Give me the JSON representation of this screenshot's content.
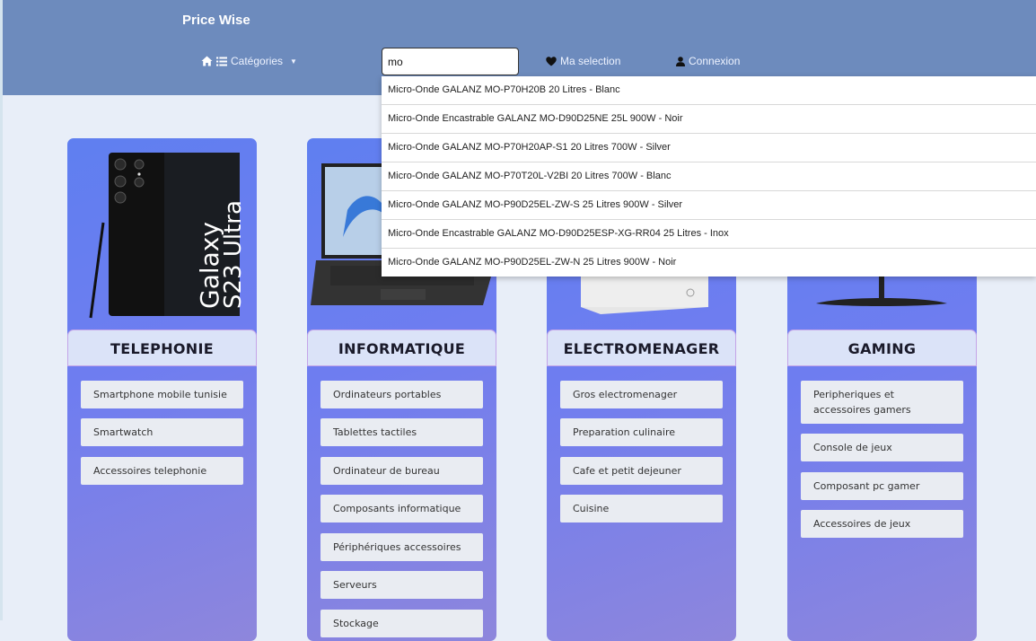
{
  "header": {
    "brand": "Price Wise",
    "categories_label": "Catégories",
    "selection_label": "Ma selection",
    "login_label": "Connexion"
  },
  "search": {
    "value": "mo",
    "placeholder": ""
  },
  "suggestions": [
    "Micro-Onde GALANZ MO-P70H20B 20 Litres - Blanc",
    "Micro-Onde Encastrable GALANZ MO-D90D25NE 25L 900W - Noir",
    "Micro-Onde GALANZ MO-P70H20AP-S1 20 Litres 700W - Silver",
    "Micro-Onde GALANZ MO-P70T20L-V2BI 20 Litres 700W - Blanc",
    "Micro-Onde GALANZ MO-P90D25EL-ZW-S 25 Litres 900W - Silver",
    "Micro-Onde Encastrable GALANZ MO-D90D25ESP-XG-RR04 25 Litres - Inox",
    "Micro-Onde GALANZ MO-P90D25EL-ZW-N 25 Litres 900W - Noir"
  ],
  "phone_text": {
    "line1": "Galaxy",
    "line2": "S23 Ultra"
  },
  "categories": [
    {
      "title": "TELEPHONIE",
      "items": [
        "Smartphone mobile tunisie",
        "Smartwatch",
        "Accessoires telephonie"
      ]
    },
    {
      "title": "INFORMATIQUE",
      "items": [
        "Ordinateurs portables",
        "Tablettes tactiles",
        "Ordinateur de bureau",
        "Composants informatique",
        "Périphériques accessoires",
        "Serveurs",
        "Stockage"
      ]
    },
    {
      "title": "ELECTROMENAGER",
      "items": [
        "Gros electromenager",
        "Preparation culinaire",
        "Cafe et petit dejeuner",
        "Cuisine"
      ]
    },
    {
      "title": "GAMING",
      "items": [
        "Peripheriques et accessoires gamers",
        "Console de jeux",
        "Composant pc gamer",
        "Accessoires de jeux"
      ]
    }
  ]
}
